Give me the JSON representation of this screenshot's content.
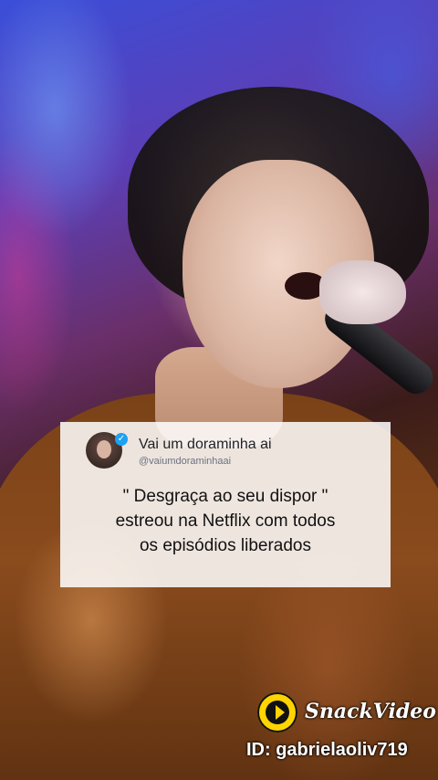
{
  "tweet": {
    "display_name": "Vai um doraminha ai",
    "handle": "@vaiumdoraminhaai",
    "verified_icon": "verified-badge-icon",
    "text_lines": [
      "\" Desgraça ao seu dispor \"",
      "estreou na Netflix com todos",
      "os episódios liberados"
    ]
  },
  "watermark": {
    "brand": "SnackVideo",
    "logo_icon": "snackvideo-logo-icon",
    "user_id": "ID: gabrielaoliv719"
  },
  "colors": {
    "card_background": "#ffffff",
    "verified_blue": "#1da1f2",
    "snack_yellow": "#ffd400"
  }
}
